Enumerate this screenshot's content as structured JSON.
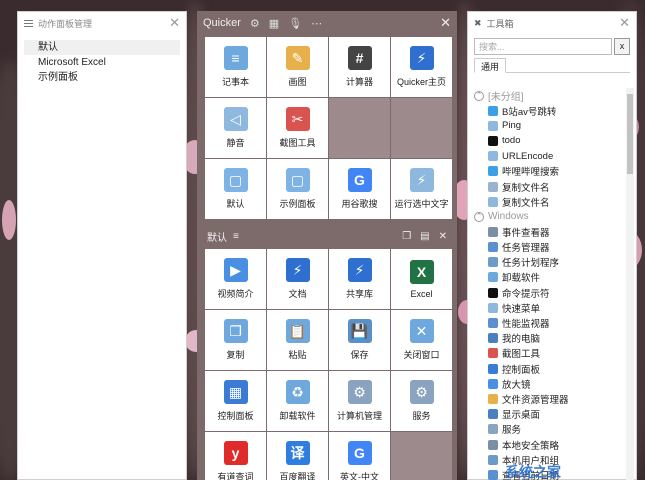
{
  "left_panel": {
    "title": "动作面板管理",
    "close_icon": "close-icon",
    "items": [
      {
        "label": "默认",
        "selected": true
      },
      {
        "label": "Microsoft Excel",
        "selected": false
      },
      {
        "label": "示例面板",
        "selected": false
      }
    ]
  },
  "quicker": {
    "title": "Quicker",
    "icons": [
      "gear-icon",
      "grid-icon",
      "microphone-icon",
      "more-icon"
    ],
    "top_grid": [
      {
        "label": "记事本",
        "icon": "notepad-icon",
        "color": "#6fa8dc",
        "glyph": "≡"
      },
      {
        "label": "画图",
        "icon": "paint-icon",
        "color": "#e8b04a",
        "glyph": "✎"
      },
      {
        "label": "计算器",
        "icon": "calculator-icon",
        "color": "#444444",
        "glyph": "#"
      },
      {
        "label": "Quicker主页",
        "icon": "quicker-bolt-icon",
        "color": "#2f6fd0",
        "glyph": "⚡"
      },
      {
        "label": "静音",
        "icon": "mute-icon",
        "color": "#8fb8de",
        "glyph": "◁"
      },
      {
        "label": "截图工具",
        "icon": "screenshot-icon",
        "color": "#d9534f",
        "glyph": "✂"
      },
      {
        "label": "",
        "icon": "",
        "color": "",
        "glyph": ""
      },
      {
        "label": "",
        "icon": "",
        "color": "",
        "glyph": ""
      },
      {
        "label": "默认",
        "icon": "panel-icon",
        "color": "#7fb2e5",
        "glyph": "▢"
      },
      {
        "label": "示例面板",
        "icon": "panel-icon",
        "color": "#7fb2e5",
        "glyph": "▢"
      },
      {
        "label": "用谷歌搜",
        "icon": "google-icon",
        "color": "#4285f4",
        "glyph": "G"
      },
      {
        "label": "运行选中文字",
        "icon": "bolt-icon",
        "color": "#8fb8de",
        "glyph": "⚡"
      }
    ],
    "sub_bar": {
      "label": "默认",
      "icons": [
        "copy-icon",
        "clipboard-icon",
        "close-icon"
      ]
    },
    "bottom_grid": [
      {
        "label": "视频简介",
        "icon": "play-icon",
        "color": "#4a90e2",
        "glyph": "▶"
      },
      {
        "label": "文档",
        "icon": "quicker-bolt-icon",
        "color": "#2f6fd0",
        "glyph": "⚡"
      },
      {
        "label": "共享库",
        "icon": "quicker-bolt-icon",
        "color": "#2f6fd0",
        "glyph": "⚡"
      },
      {
        "label": "Excel",
        "icon": "excel-icon",
        "color": "#217346",
        "glyph": "X"
      },
      {
        "label": "复制",
        "icon": "copy-icon",
        "color": "#6fa8dc",
        "glyph": "❐"
      },
      {
        "label": "粘贴",
        "icon": "paste-icon",
        "color": "#6fa8dc",
        "glyph": "📋"
      },
      {
        "label": "保存",
        "icon": "save-icon",
        "color": "#5b8fc8",
        "glyph": "💾"
      },
      {
        "label": "关闭窗口",
        "icon": "close-window-icon",
        "color": "#6fa8dc",
        "glyph": "✕"
      },
      {
        "label": "控制面板",
        "icon": "control-panel-icon",
        "color": "#3a7bd5",
        "glyph": "▦"
      },
      {
        "label": "卸载软件",
        "icon": "recycle-icon",
        "color": "#6fa8dc",
        "glyph": "♻"
      },
      {
        "label": "计算机管理",
        "icon": "computer-management-icon",
        "color": "#8aa4c0",
        "glyph": "⚙"
      },
      {
        "label": "服务",
        "icon": "services-icon",
        "color": "#8aa4c0",
        "glyph": "⚙"
      },
      {
        "label": "有道查词",
        "icon": "youdao-icon",
        "color": "#e02b2b",
        "glyph": "y"
      },
      {
        "label": "百度翻译",
        "icon": "baidu-translate-icon",
        "color": "#2f7de1",
        "glyph": "译"
      },
      {
        "label": "英文-中文",
        "icon": "google-translate-icon",
        "color": "#4285f4",
        "glyph": "G"
      },
      {
        "label": "",
        "icon": "",
        "color": "",
        "glyph": ""
      }
    ]
  },
  "toolbox": {
    "title": "工具箱",
    "search_placeholder": "搜索...",
    "clear_label": "x",
    "tab": "通用",
    "groups": [
      {
        "name": "[未分组]",
        "items": [
          {
            "label": "B站av号跳转",
            "icon": "bilibili-icon",
            "color": "#3ba0e6"
          },
          {
            "label": "Ping",
            "icon": "bolt-icon",
            "color": "#8fb8de"
          },
          {
            "label": "todo",
            "icon": "checkbox-icon",
            "color": "#111111"
          },
          {
            "label": "URLEncode",
            "icon": "bolt-icon",
            "color": "#8fb8de"
          },
          {
            "label": "哔哩哔哩搜索",
            "icon": "bilibili-icon",
            "color": "#3ba0e6"
          },
          {
            "label": "复制文件名",
            "icon": "file-icon",
            "color": "#9ab3cc"
          },
          {
            "label": "复制文件名",
            "icon": "bolt-icon",
            "color": "#8fb8de"
          }
        ]
      },
      {
        "name": "Windows",
        "items": [
          {
            "label": "事件查看器",
            "icon": "event-viewer-icon",
            "color": "#7a8fa6"
          },
          {
            "label": "任务管理器",
            "icon": "task-manager-icon",
            "color": "#5a8fd0"
          },
          {
            "label": "任务计划程序",
            "icon": "task-scheduler-icon",
            "color": "#6c9bc9"
          },
          {
            "label": "卸载软件",
            "icon": "uninstall-icon",
            "color": "#6fa8dc"
          },
          {
            "label": "命令提示符",
            "icon": "cmd-icon",
            "color": "#111111"
          },
          {
            "label": "快速菜单",
            "icon": "bolt-icon",
            "color": "#8fb8de"
          },
          {
            "label": "性能监视器",
            "icon": "performance-icon",
            "color": "#5a8fd0"
          },
          {
            "label": "我的电脑",
            "icon": "computer-icon",
            "color": "#4a7fc0"
          },
          {
            "label": "截图工具",
            "icon": "screenshot-icon",
            "color": "#d9534f"
          },
          {
            "label": "控制面板",
            "icon": "control-panel-icon",
            "color": "#3a7bd5"
          },
          {
            "label": "放大镜",
            "icon": "magnifier-icon",
            "color": "#4a90e2"
          },
          {
            "label": "文件资源管理器",
            "icon": "folder-icon",
            "color": "#e8b04a"
          },
          {
            "label": "显示桌面",
            "icon": "desktop-icon",
            "color": "#4a7fc0"
          },
          {
            "label": "服务",
            "icon": "services-icon",
            "color": "#8aa4c0"
          },
          {
            "label": "本地安全策略",
            "icon": "security-policy-icon",
            "color": "#7a8fa6"
          },
          {
            "label": "本机用户和组",
            "icon": "users-icon",
            "color": "#6c9bc9"
          },
          {
            "label": "查看当前日期",
            "icon": "calendar-icon",
            "color": "#5a8fd0"
          }
        ]
      }
    ]
  },
  "watermark": "系统之家"
}
